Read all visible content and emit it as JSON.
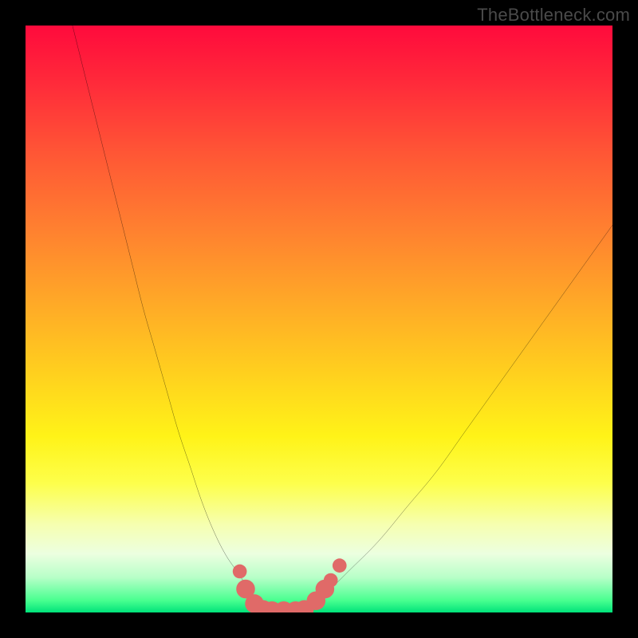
{
  "attribution": "TheBottleneck.com",
  "chart_data": {
    "type": "line",
    "title": "",
    "xlabel": "",
    "ylabel": "",
    "xlim": [
      0,
      100
    ],
    "ylim": [
      0,
      100
    ],
    "background_gradient": {
      "top": "#ff0a3c",
      "mid": "#ffe418",
      "bottom": "#00e27a",
      "meaning": "top = bad (red), bottom = good (green)"
    },
    "series": [
      {
        "name": "curve-left",
        "x": [
          8,
          10,
          12,
          14,
          16,
          18,
          20,
          22,
          24,
          26,
          28,
          30,
          32,
          34,
          36,
          38,
          39,
          40
        ],
        "y": [
          100,
          92,
          84,
          76,
          68,
          60,
          52,
          45,
          38,
          31,
          25,
          19,
          14,
          10,
          7,
          4,
          2,
          0
        ]
      },
      {
        "name": "valley-floor",
        "x": [
          40,
          41,
          42,
          43,
          44,
          45,
          46,
          47,
          48
        ],
        "y": [
          0,
          0,
          0,
          0,
          0,
          0,
          0,
          0,
          0
        ]
      },
      {
        "name": "curve-right",
        "x": [
          48,
          50,
          52,
          55,
          60,
          65,
          70,
          75,
          80,
          85,
          90,
          95,
          100
        ],
        "y": [
          0,
          2,
          4,
          7,
          12,
          18,
          24,
          31,
          38,
          45,
          52,
          59,
          66
        ]
      }
    ],
    "markers": {
      "name": "highlighted-points",
      "color": "#e06a68",
      "points": [
        {
          "x": 36.5,
          "y": 7,
          "r": 1.2
        },
        {
          "x": 37.5,
          "y": 4,
          "r": 1.6
        },
        {
          "x": 39.0,
          "y": 1.5,
          "r": 1.6
        },
        {
          "x": 40.5,
          "y": 0.5,
          "r": 1.6
        },
        {
          "x": 42.0,
          "y": 0.3,
          "r": 1.6
        },
        {
          "x": 44.0,
          "y": 0.3,
          "r": 1.6
        },
        {
          "x": 46.0,
          "y": 0.3,
          "r": 1.6
        },
        {
          "x": 47.5,
          "y": 0.5,
          "r": 1.6
        },
        {
          "x": 49.5,
          "y": 2.0,
          "r": 1.6
        },
        {
          "x": 51.0,
          "y": 4.0,
          "r": 1.6
        },
        {
          "x": 52.0,
          "y": 5.5,
          "r": 1.2
        },
        {
          "x": 53.5,
          "y": 8.0,
          "r": 1.2
        }
      ]
    }
  }
}
